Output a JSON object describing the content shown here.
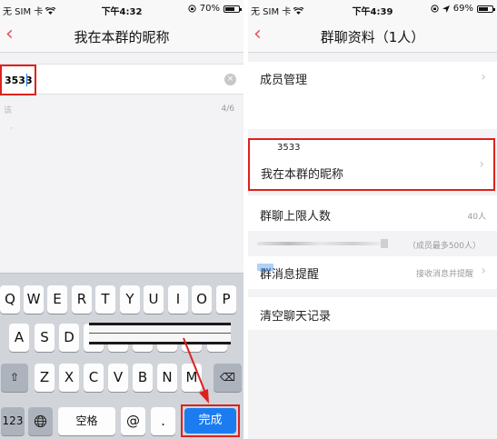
{
  "left": {
    "status": {
      "carrier": "无 SIM 卡",
      "time": "下午4:32",
      "battery": "70%",
      "battery_level": 0.7
    },
    "nav": {
      "back": "‹",
      "title": "我在本群的昵称"
    },
    "input": {
      "value": "3533",
      "clear": "×"
    },
    "hint": "该",
    "char_count": "4/6",
    "hint_mark": "’",
    "keyboard": {
      "row1": [
        "Q",
        "W",
        "E",
        "R",
        "T",
        "Y",
        "U",
        "I",
        "O",
        "P"
      ],
      "row2": [
        "A",
        "S",
        "D",
        "F",
        "G",
        "H",
        "J",
        "K",
        "L"
      ],
      "row3": [
        "Z",
        "X",
        "C",
        "V",
        "B",
        "N",
        "M"
      ],
      "shift": "⇧",
      "delete": "⌫",
      "numbers": "123",
      "globe": "🌐",
      "space": "空格",
      "at": "@",
      "dot": ".",
      "done": "完成"
    }
  },
  "right": {
    "status": {
      "carrier": "无 SIM 卡",
      "time": "下午4:39",
      "battery": "69%",
      "battery_level": 0.69
    },
    "nav": {
      "back": "‹",
      "title": "群聊资料（1人）"
    },
    "member_management": "成员管理",
    "nickname_value": "3533",
    "nickname_label": "我在本群的昵称",
    "group_limit_label": "群聊上限人数",
    "group_limit_value": "40人",
    "group_limit_note": "（成员最多500人）",
    "message_reminder_label": "群消息提醒",
    "message_reminder_value": "接收消息并提醒",
    "clear_history": "清空聊天记录",
    "chevron": "›"
  }
}
